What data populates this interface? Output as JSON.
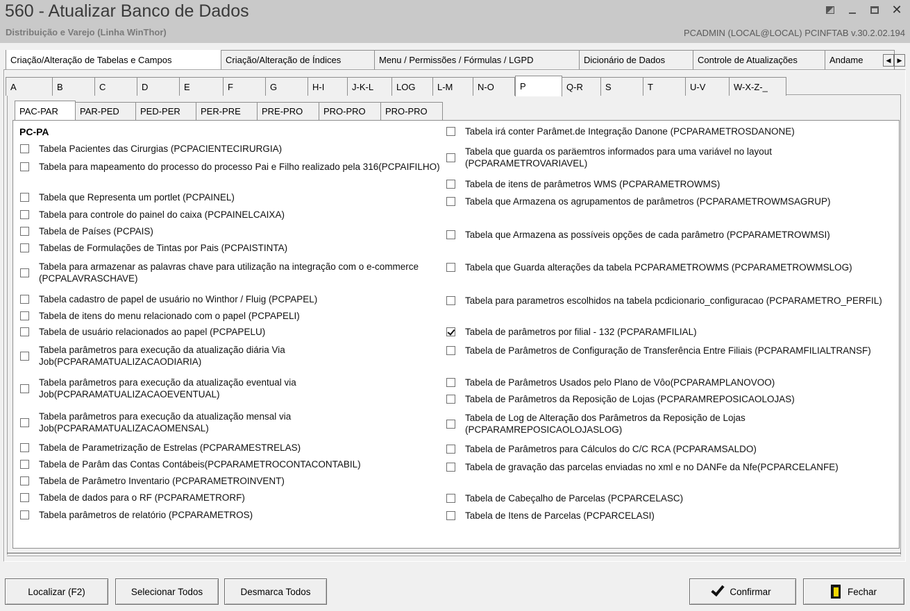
{
  "window": {
    "title": "560 - Atualizar Banco de Dados",
    "subtitle": "Distribuição e Varejo (Linha WinThor)",
    "info": "PCADMIN (LOCAL@LOCAL)   PCINFTAB  v.30.2.02.194"
  },
  "main_tabs": [
    "Criação/Alteração de Tabelas e Campos",
    "Criação/Alteração de Índices",
    "Menu / Permissões / Fórmulas / LGPD",
    "Dicionário de Dados",
    "Controle de Atualizações",
    "Andame"
  ],
  "letter_tabs": [
    "A",
    "B",
    "C",
    "D",
    "E",
    "F",
    "G",
    "H-I",
    "J-K-L",
    "LOG",
    "L-M",
    "N-O",
    "P",
    "Q-R",
    "S",
    "T",
    "U-V",
    "W-X-Z-_"
  ],
  "sub_tabs": [
    "PAC-PAR",
    "PAR-PED",
    "PED-PER",
    "PER-PRE",
    "PRE-PRO",
    "PRO-PRO",
    "PRO-PRO"
  ],
  "group_title": "PC-PA",
  "left_items": [
    {
      "label": "Tabela Pacientes das Cirurgias (PCPACIENTECIRURGIA)",
      "checked": false
    },
    {
      "label": "Tabela para mapeamento do processo do processo Pai e Filho realizado pela 316(PCPAIFILHO)",
      "checked": false
    },
    {
      "label": "Tabela que Representa um portlet (PCPAINEL)",
      "checked": false
    },
    {
      "label": "Tabela para controle do painel do caixa (PCPAINELCAIXA)",
      "checked": false
    },
    {
      "label": "Tabela de Países (PCPAIS)",
      "checked": false
    },
    {
      "label": "Tabelas de Formulações de Tintas por Pais (PCPAISTINTA)",
      "checked": false
    },
    {
      "label": "Tabela para armazenar as palavras chave para utilização na integração com o e-commerce (PCPALAVRASCHAVE)",
      "checked": false
    },
    {
      "label": "Tabela cadastro de papel de usuário no Winthor / Fluig (PCPAPEL)",
      "checked": false
    },
    {
      "label": "Tabela de itens do menu relacionado com o papel (PCPAPELI)",
      "checked": false
    },
    {
      "label": "Tabela de usuário relacionados ao papel (PCPAPELU)",
      "checked": false
    },
    {
      "label": "Tabela parâmetros para execução da atualização diária Via Job(PCPARAMATUALIZACAODIARIA)",
      "checked": false
    },
    {
      "label": "Tabela parâmetros para execução da atualização eventual via Job(PCPARAMATUALIZACAOEVENTUAL)",
      "checked": false
    },
    {
      "label": "Tabela parâmetros para execução da atualização mensal via Job(PCPARAMATUALIZACAOMENSAL)",
      "checked": false
    },
    {
      "label": "Tabela de Parametrização de Estrelas (PCPARAMESTRELAS)",
      "checked": false
    },
    {
      "label": "Tabela de Parâm das Contas Contábeis(PCPARAMETROCONTACONTABIL)",
      "checked": false
    },
    {
      "label": "Tabela de Parâmetro Inventario (PCPARAMETROINVENT)",
      "checked": false
    },
    {
      "label": "Tabela de dados para o RF (PCPARAMETRORF)",
      "checked": false
    },
    {
      "label": "Tabela parâmetros de relatório (PCPARAMETROS)",
      "checked": false
    }
  ],
  "right_items": [
    {
      "label": "Tabela irá conter Parâmet.de Integração Danone (PCPARAMETROSDANONE)",
      "checked": false
    },
    {
      "label": "Tabela que guarda os paräemtros informados para uma variável no layout (PCPARAMETROVARIAVEL)",
      "checked": false
    },
    {
      "label": "Tabela de itens de parâmetros WMS (PCPARAMETROWMS)",
      "checked": false
    },
    {
      "label": "Tabela que Armazena os agrupamentos de parâmetros (PCPARAMETROWMSAGRUP)",
      "checked": false
    },
    {
      "label": "Tabela que Armazena as possíveis opções de cada parâmetro (PCPARAMETROWMSI)",
      "checked": false
    },
    {
      "label": "Tabela que Guarda alterações da tabela PCPARAMETROWMS (PCPARAMETROWMSLOG)",
      "checked": false
    },
    {
      "label": "Tabela para parametros escolhidos na tabela pcdicionario_configuracao (PCPARAMETRO_PERFIL)",
      "checked": false
    },
    {
      "label": "Tabela de parâmetros por filial - 132 (PCPARAMFILIAL)",
      "checked": true
    },
    {
      "label": "Tabela de Parâmetros de Configuração de Transferência Entre Filiais (PCPARAMFILIALTRANSF)",
      "checked": false
    },
    {
      "label": "Tabela de Parâmetros Usados pelo Plano de Vôo(PCPARAMPLANOVOO)",
      "checked": false
    },
    {
      "label": "Tabela de Parâmetros da Reposição de Lojas (PCPARAMREPOSICAOLOJAS)",
      "checked": false
    },
    {
      "label": "Tabela de Log de Alteração dos Parâmetros da Reposição de Lojas (PCPARAMREPOSICAOLOJASLOG)",
      "checked": false
    },
    {
      "label": "Tabela de Parâmetros para Cálculos do C/C RCA (PCPARAMSALDO)",
      "checked": false
    },
    {
      "label": "Tabela de gravação das parcelas enviadas no xml e no DANFe da Nfe(PCPARCELANFE)",
      "checked": false
    },
    {
      "label": "Tabela de Cabeçalho de Parcelas (PCPARCELASC)",
      "checked": false
    },
    {
      "label": "Tabela de Itens de Parcelas (PCPARCELASI)",
      "checked": false
    }
  ],
  "buttons": {
    "localizar": "Localizar (F2)",
    "selecionar": "Selecionar Todos",
    "desmarca": "Desmarca Todos",
    "confirmar": "Confirmar",
    "fechar": "Fechar"
  }
}
